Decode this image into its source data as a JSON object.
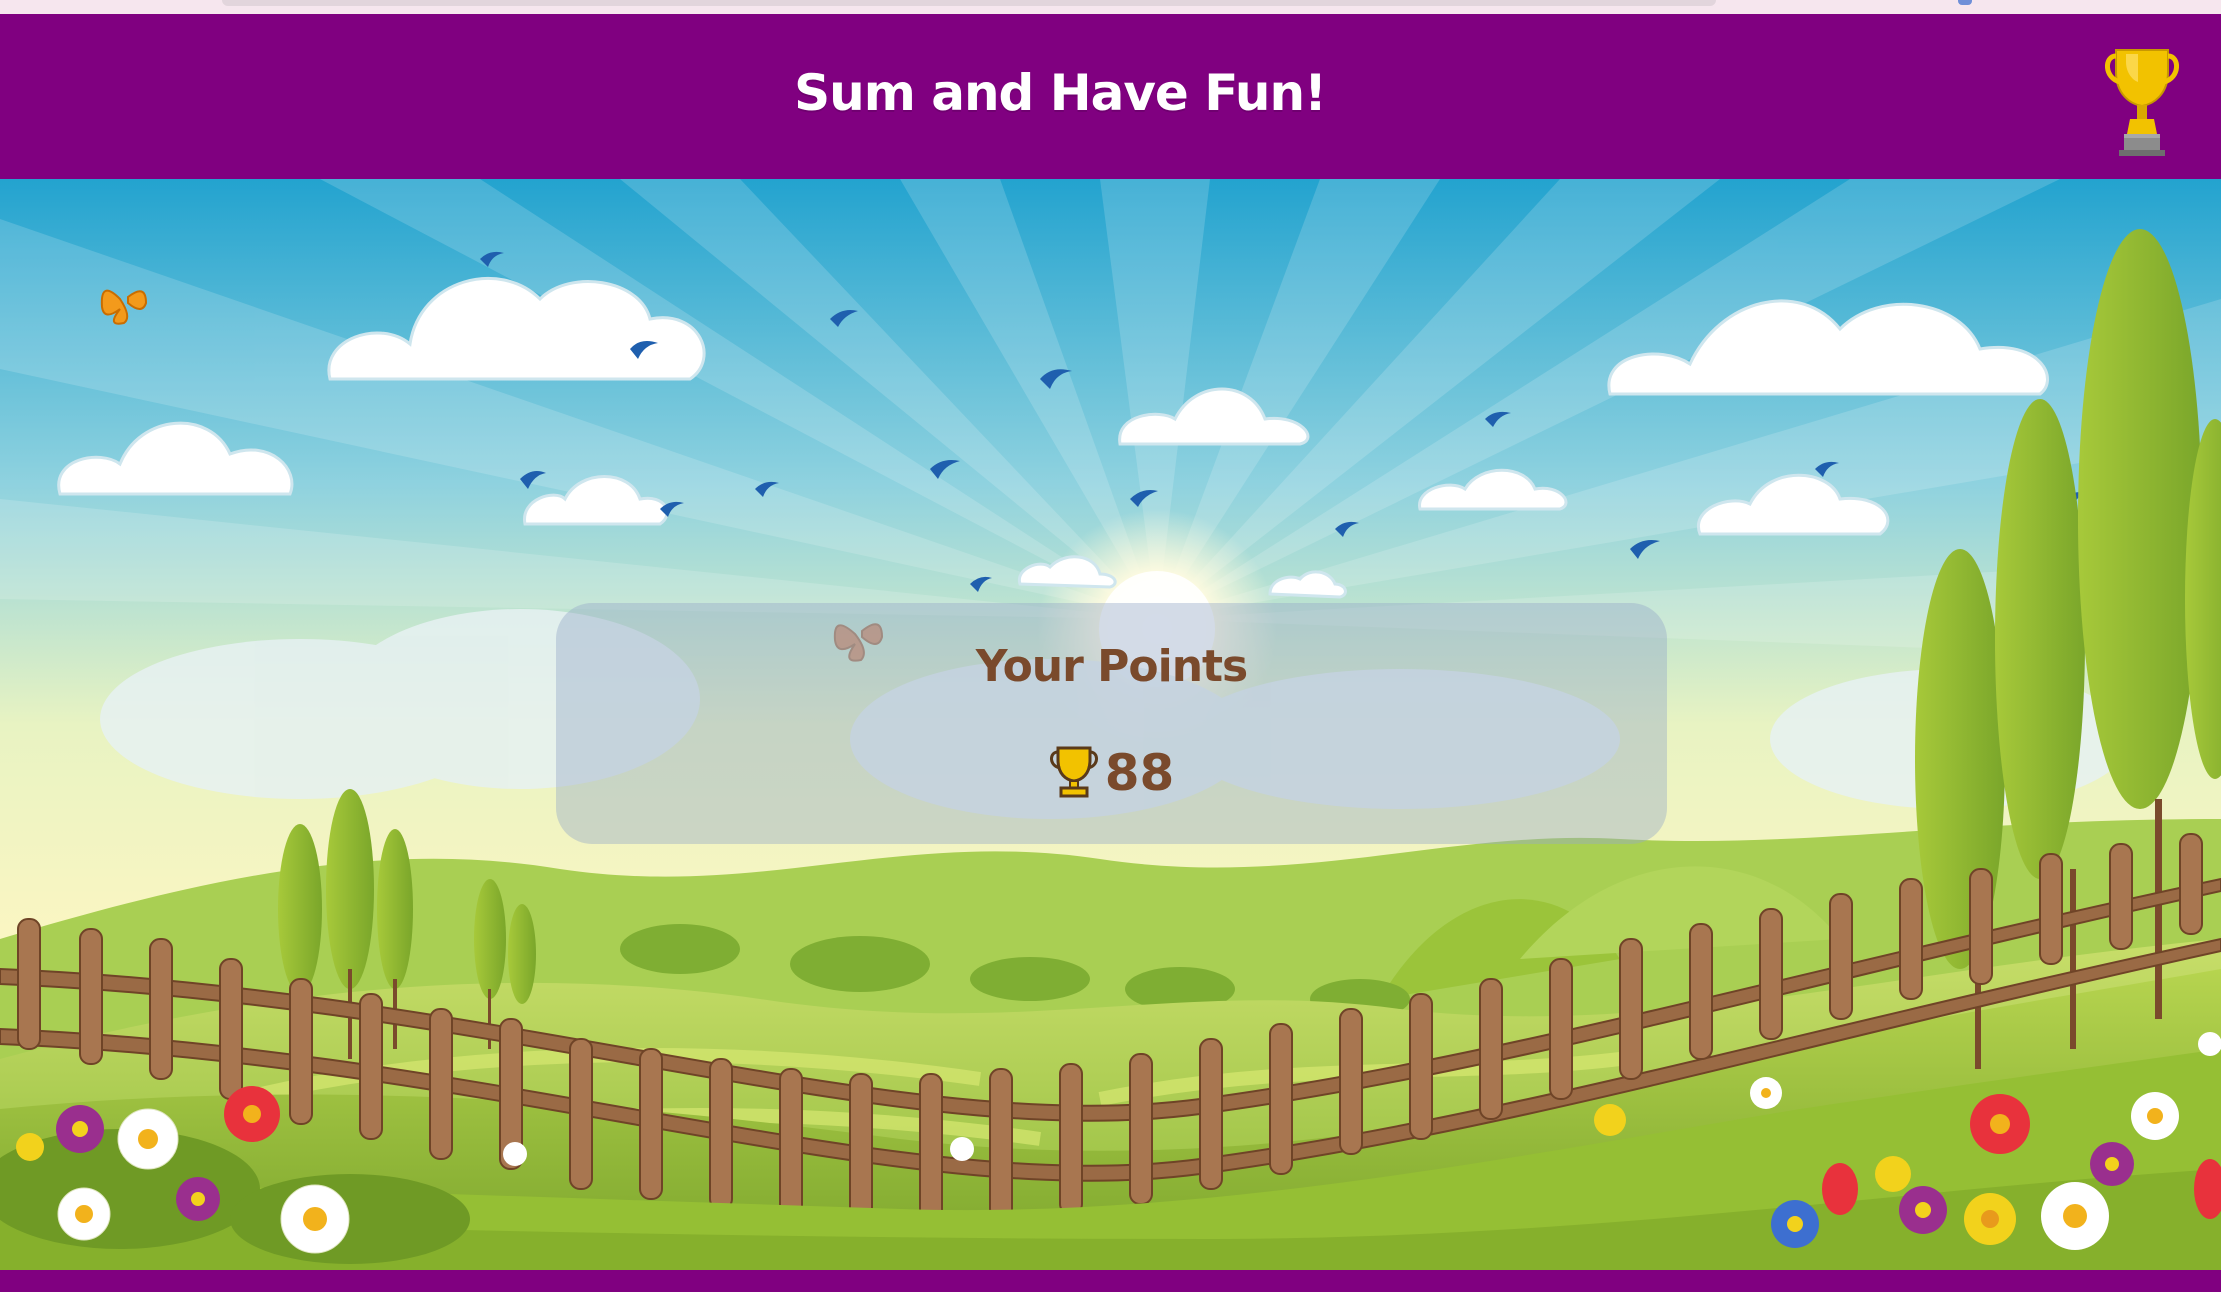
{
  "header": {
    "title": "Sum and Have Fun!",
    "trophy_icon": "trophy-icon"
  },
  "points": {
    "title": "Your Points",
    "icon": "trophy-icon",
    "value": "88"
  },
  "colors": {
    "header_bg": "#800080",
    "text_brown": "#7a4a2c",
    "sky_top": "#2ba6d0",
    "sky_bottom": "#fdf6c0",
    "grass": "#9bc43a",
    "trophy_gold": "#f2c200"
  }
}
